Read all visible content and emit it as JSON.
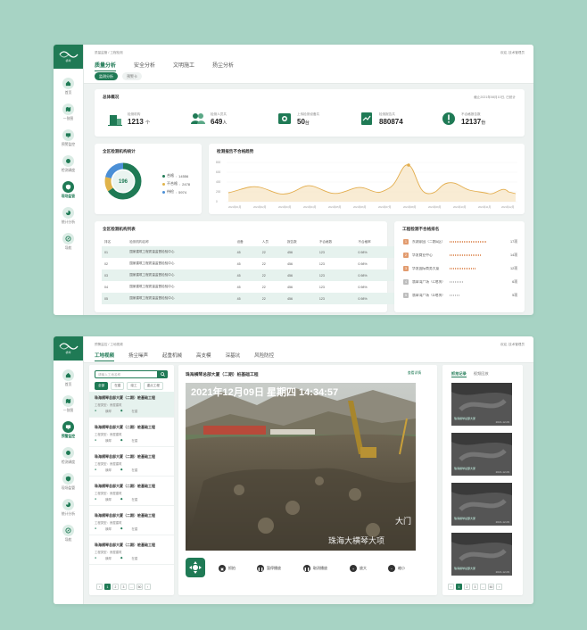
{
  "nav": {
    "items": [
      {
        "label": "首页",
        "icon": "home-icon"
      },
      {
        "label": "一张图",
        "icon": "map-icon"
      },
      {
        "label": "预警监控",
        "icon": "monitor-icon"
      },
      {
        "label": "检测调度",
        "icon": "dispatch-icon"
      },
      {
        "label": "现场监管",
        "icon": "shield-icon"
      },
      {
        "label": "统计分析",
        "icon": "pie-chart-icon"
      },
      {
        "label": "导航",
        "icon": "compass-icon"
      }
    ]
  },
  "panel1": {
    "breadcrumb": "质量监管 / 工程检测",
    "user": "欢迎, 技术管理员",
    "tabs": [
      "质量分析",
      "安全分析",
      "文明施工",
      "扬尘分析"
    ],
    "subtabs": [
      "监测分析",
      "预警卡"
    ],
    "overview": {
      "title": "总体概况",
      "updated": "截止2021年08月10日, 已统计",
      "stats": [
        {
          "label": "检测机构",
          "value": "1213",
          "unit": "个"
        },
        {
          "label": "检测人员共",
          "value": "649",
          "unit": "人"
        },
        {
          "label": "上传检测设备共",
          "value": "50",
          "unit": "台"
        },
        {
          "label": "检测报告共",
          "value": "880874",
          "unit": ""
        },
        {
          "label": "不合格报告数",
          "value": "12137",
          "unit": "份"
        }
      ]
    },
    "donut": {
      "title": "全区检测机构统计",
      "center": "196",
      "legend": [
        {
          "label": "合格",
          "value": "14556",
          "color": "#1f7a55"
        },
        {
          "label": "不合格",
          "value": "2478",
          "color": "#e0b34a"
        },
        {
          "label": "待检",
          "value": "5974",
          "color": "#4b8fd6"
        }
      ]
    },
    "trend": {
      "title": "检测报告不合格趋势",
      "yticks": [
        "800",
        "600",
        "400",
        "200",
        "0"
      ],
      "xticks": [
        "2021年01月",
        "2021年02月",
        "2021年03月",
        "2021年04月",
        "2021年05月",
        "2021年06月",
        "2021年07月",
        "2021年08月",
        "2021年09月",
        "2021年10月",
        "2021年11月",
        "2021年12月"
      ]
    },
    "table": {
      "title": "全区检测机构列表",
      "columns": [
        "排名",
        "检测机构名称",
        "设备",
        "人员",
        "报告数",
        "不合格数",
        "不合格率"
      ],
      "rows": [
        [
          "01",
          "国家建筑工程质量监督检验中心",
          "45",
          "22",
          "456",
          "123",
          "0.98%"
        ],
        [
          "02",
          "国家建筑工程质量监督检验中心",
          "45",
          "22",
          "456",
          "123",
          "0.98%"
        ],
        [
          "03",
          "国家建筑工程质量监督检验中心",
          "45",
          "22",
          "456",
          "123",
          "0.98%"
        ],
        [
          "04",
          "国家建筑工程质量监督检验中心",
          "45",
          "22",
          "456",
          "123",
          "0.98%"
        ],
        [
          "05",
          "国家建筑工程质量监督检验中心",
          "45",
          "22",
          "456",
          "123",
          "0.98%"
        ]
      ]
    },
    "ranking": {
      "title": "工程检测不合格排名",
      "items": [
        {
          "rank": "1",
          "name": "东湖家园（二期A区）",
          "value": "17项",
          "pct": 0.85,
          "color": "#e29b6e"
        },
        {
          "rank": "2",
          "name": "华发商业中心",
          "value": "14项",
          "pct": 0.72,
          "color": "#e29b6e"
        },
        {
          "rank": "3",
          "name": "华发国际商务大厦",
          "value": "12项",
          "pct": 0.6,
          "color": "#e29b6e"
        },
        {
          "rank": "4",
          "name": "翡翠湾广场（C地块）",
          "value": "6项",
          "pct": 0.33,
          "color": "#c5c5c5"
        },
        {
          "rank": "5",
          "name": "翡翠湾广场（D地块）",
          "value": "5项",
          "pct": 0.25,
          "color": "#c5c5c5"
        }
      ]
    }
  },
  "panel2": {
    "breadcrumb": "预警监控 / 工地视频",
    "user": "欢迎, 技术管理员",
    "tabs": [
      "工地视频",
      "扬尘噪声",
      "起重机械",
      "高支模",
      "深基坑",
      "风险防控"
    ],
    "search_placeholder": "请输入工地名称",
    "chips": [
      "全部",
      "在建",
      "竣工",
      "重点工程"
    ],
    "projects": [
      {
        "name": "珠海横琴总部大厦（二期）桩基础工程",
        "type": "工程类型：房屋建筑",
        "loc": "横琴",
        "status": "在建"
      },
      {
        "name": "珠海横琴总部大厦（二期）桩基础工程",
        "type": "工程类型：房屋建筑",
        "loc": "横琴",
        "status": "在建"
      },
      {
        "name": "珠海横琴总部大厦（二期）桩基础工程",
        "type": "工程类型：房屋建筑",
        "loc": "横琴",
        "status": "在建"
      },
      {
        "name": "珠海横琴总部大厦（二期）桩基础工程",
        "type": "工程类型：房屋建筑",
        "loc": "横琴",
        "status": "在建"
      },
      {
        "name": "珠海横琴总部大厦（二期）桩基础工程",
        "type": "工程类型：房屋建筑",
        "loc": "横琴",
        "status": "在建"
      },
      {
        "name": "珠海横琴总部大厦（二期）桩基础工程",
        "type": "工程类型：房屋建筑",
        "loc": "横琴",
        "status": "在建"
      }
    ],
    "pager": [
      "‹",
      "1",
      "2",
      "3",
      "...",
      "50",
      "›"
    ],
    "video": {
      "title": "珠海横琴总部大厦（二期）桩基础工程",
      "more": "查看详情",
      "overlay": "2021年12月09日  星期四  14:34:57",
      "watermark": "珠海大横琴大项",
      "gate": "大门"
    },
    "controls": [
      "抓拍",
      "暂停播放",
      "取消播放",
      "放大",
      "缩小"
    ],
    "right": {
      "tabs": [
        "抓拍记录",
        "视频回放"
      ],
      "thumbs": [
        {
          "label": "珠海横琴总部大厦",
          "date": "2021-12-09"
        },
        {
          "label": "珠海横琴总部大厦",
          "date": "2021-12-09"
        },
        {
          "label": "珠海横琴总部大厦",
          "date": "2021-12-09"
        },
        {
          "label": "珠海横琴总部大厦",
          "date": "2021-12-09"
        }
      ],
      "pager": [
        "‹",
        "1",
        "2",
        "3",
        "...",
        "50",
        "›"
      ]
    }
  },
  "brand_color": "#1f7a55",
  "logo_text": "横琴"
}
